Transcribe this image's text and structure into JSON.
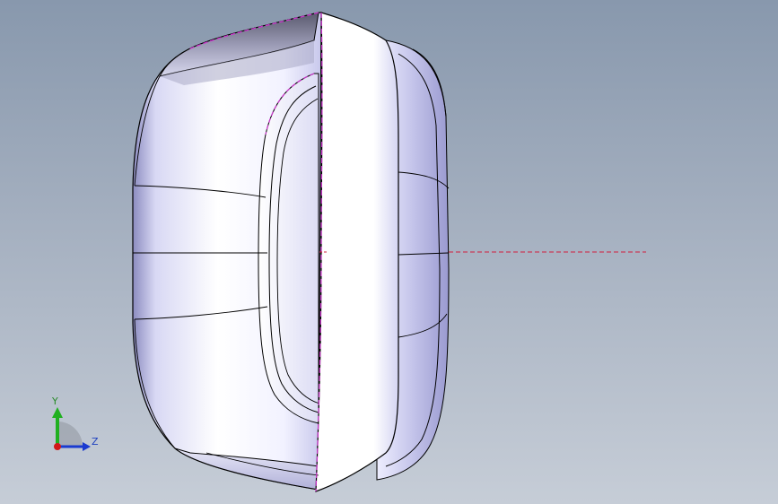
{
  "viewport": {
    "background_top": "#8898ad",
    "background_bottom": "#c6cdd7"
  },
  "model": {
    "body_color": "#ffffff",
    "shade_color": "#b8b8e8",
    "edge_color": "#000000",
    "highlight_edge_color": "#cc33cc",
    "centerline_color": "#d21e3c"
  },
  "triad": {
    "y_label": "Y",
    "z_label": "Z",
    "y_color": "#20b020",
    "z_color": "#1a3ad0",
    "x_color": "#d21818",
    "y_label_color": "#2a8a2a",
    "z_label_color": "#1d3fbf"
  }
}
